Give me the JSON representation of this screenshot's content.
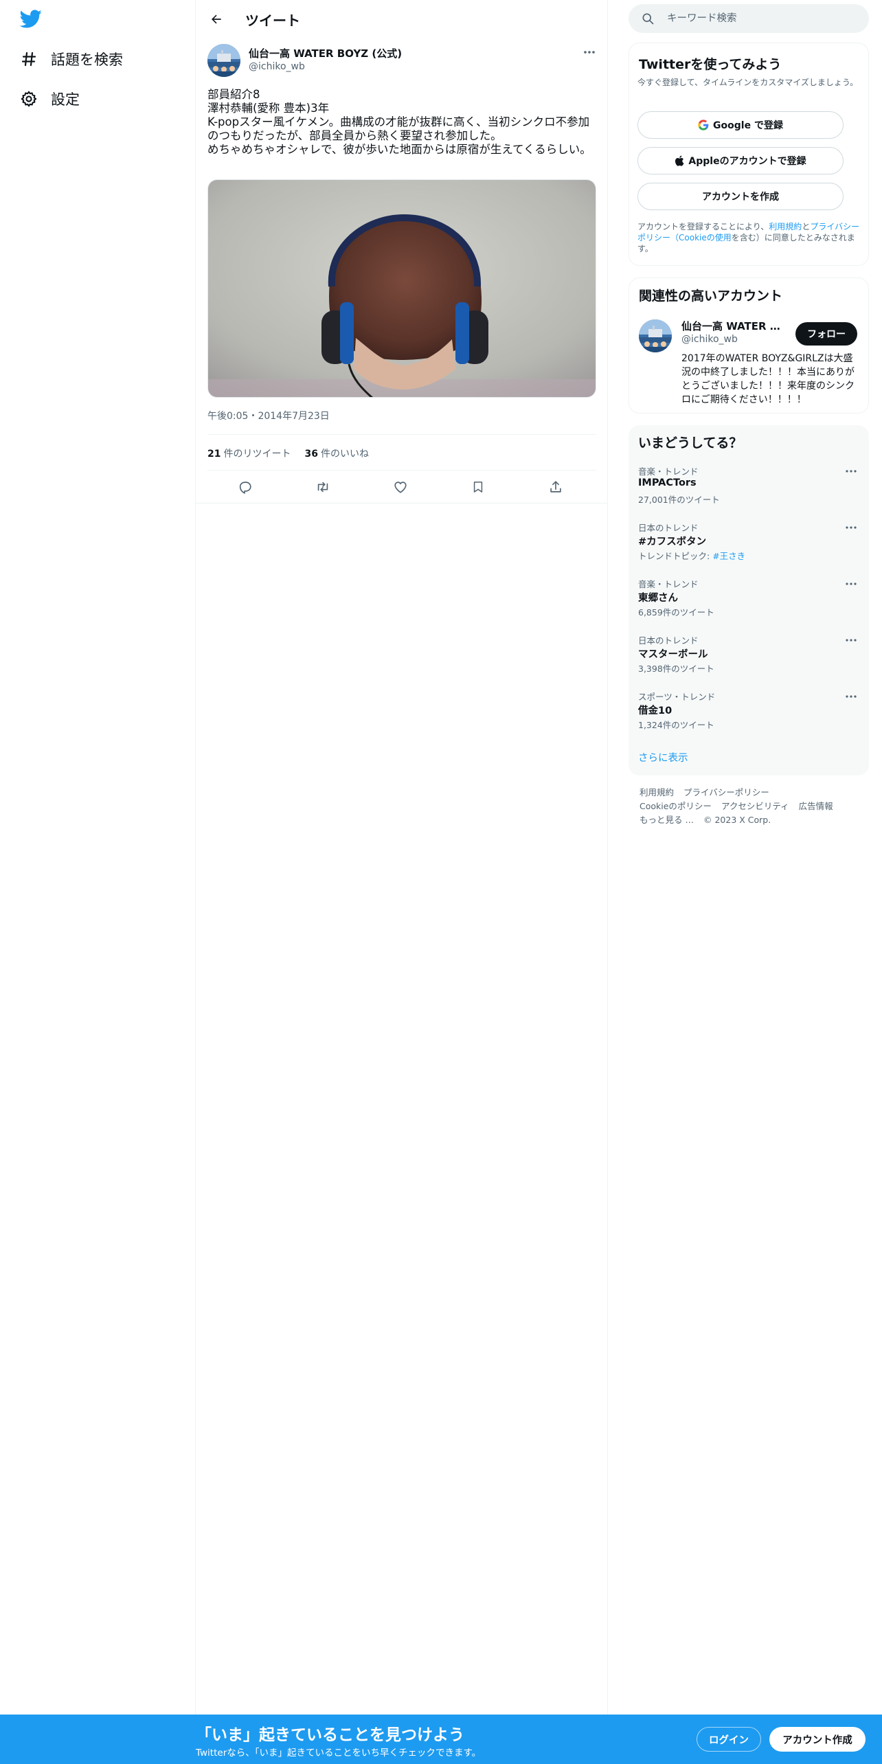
{
  "colors": {
    "accent": "#1d9bf0",
    "text": "#0f1419",
    "muted": "#536471",
    "border": "#eff3f4"
  },
  "nav": {
    "logo_icon": "twitter-bird-icon",
    "items": [
      {
        "label": "話題を検索",
        "icon": "hashtag-icon"
      },
      {
        "label": "設定",
        "icon": "gear-icon"
      }
    ]
  },
  "header": {
    "title": "ツイート",
    "back_icon": "arrow-left-icon"
  },
  "tweet": {
    "author_name": "仙台一高 WATER BOYZ (公式)",
    "author_handle": "@ichiko_wb",
    "lines": [
      "部員紹介8",
      "澤村恭輔(愛称 豊本)3年",
      "K-popスター風イケメン。曲構成の才能が抜群に高く、当初シンクロ不参加のつもりだったが、部員全員から熱く要望され参加した。",
      "めちゃめちゃオシャレで、彼が歩いた地面からは原宿が生えてくるらしい。"
    ],
    "media_alt": "headphones-portrait-photo",
    "timestamp": "午後0:05・2014年7月23日",
    "retweets": "21",
    "retweets_label": "件のリツイート",
    "likes": "36",
    "likes_label": "件のいいね",
    "actions": [
      "reply-icon",
      "retweet-icon",
      "like-icon",
      "bookmark-icon",
      "share-icon"
    ]
  },
  "search": {
    "placeholder": "キーワード検索"
  },
  "signup": {
    "title": "Twitterを使ってみよう",
    "subtitle": "今すぐ登録して、タイムラインをカスタマイズしましょう。",
    "google_label": "Google で登録",
    "apple_label": "Appleのアカウントで登録",
    "create_label": "アカウントを作成",
    "legal_prefix": "アカウントを登録することにより、",
    "legal_terms": "利用規約",
    "legal_and": "と",
    "legal_privacy": "プライバシーポリシー（Cookieの使用",
    "legal_suffix": "を含む）に同意したとみなされます。"
  },
  "related": {
    "title": "関連性の高いアカウント",
    "name": "仙台一高 WATER BOYZ (公式)",
    "handle": "@ichiko_wb",
    "follow_label": "フォロー",
    "bio": "2017年のWATER BOYZ&GIRLZは大盛況の中終了しました！！！本当にありがとうございました！！！来年度のシンクロにご期待ください！！！！"
  },
  "trends": {
    "title": "いまどうしてる？",
    "items": [
      {
        "meta": "音楽・トレンド",
        "name": "IMPACTors",
        "count": "27,001件のツイート"
      },
      {
        "meta": "日本のトレンド",
        "name": "#カフスボタン",
        "count_prefix": "トレンドトピック: ",
        "count_link": "#王さき"
      },
      {
        "meta": "音楽・トレンド",
        "name": "東郷さん",
        "count": "6,859件のツイート"
      },
      {
        "meta": "日本のトレンド",
        "name": "マスターボール",
        "count": "3,398件のツイート"
      },
      {
        "meta": "スポーツ・トレンド",
        "name": "借金10",
        "count": "1,324件のツイート"
      }
    ],
    "show_more": "さらに表示"
  },
  "footer": {
    "links": [
      "利用規約",
      "プライバシーポリシー",
      "Cookieのポリシー",
      "アクセシビリティ",
      "広告情報",
      "もっと見る …",
      "© 2023 X Corp."
    ]
  },
  "bottom_bar": {
    "title": "「いま」起きていることを見つけよう",
    "subtitle": "Twitterなら、「いま」起きていることをいち早くチェックできます。",
    "login_label": "ログイン",
    "signup_label": "アカウント作成"
  }
}
